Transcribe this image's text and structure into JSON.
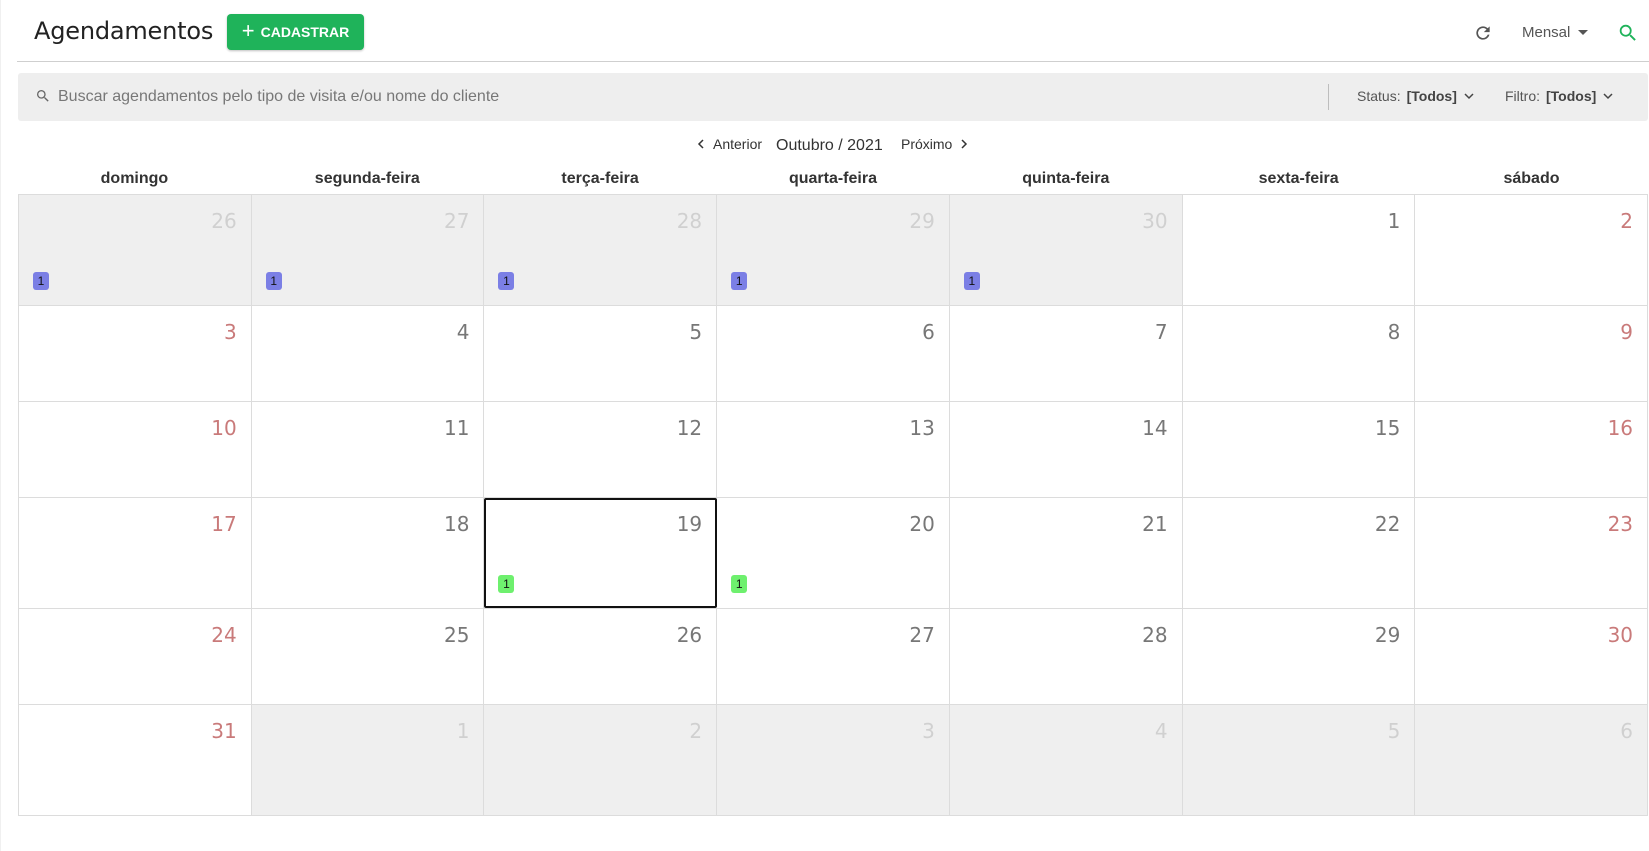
{
  "header": {
    "title": "Agendamentos",
    "add_button_label": "CADASTRAR",
    "view_mode": "Mensal"
  },
  "search": {
    "placeholder": "Buscar agendamentos pelo tipo de visita e/ou nome do cliente",
    "status_label": "Status:",
    "status_value": "[Todos]",
    "filter_label": "Filtro:",
    "filter_value": "[Todos]"
  },
  "nav": {
    "prev_label": "Anterior",
    "month_label": "Outubro / 2021",
    "next_label": "Próximo"
  },
  "colors": {
    "primary": "#1fb35a",
    "badge_blue": "#7b7fe5",
    "badge_green": "#6ef06e",
    "weekend_text": "#c97a7a"
  },
  "calendar": {
    "weekdays": [
      "domingo",
      "segunda-feira",
      "terça-feira",
      "quarta-feira",
      "quinta-feira",
      "sexta-feira",
      "sábado"
    ],
    "weeks": [
      [
        {
          "day": "26",
          "outside": true,
          "badge": "1",
          "badge_color": "blue"
        },
        {
          "day": "27",
          "outside": true,
          "badge": "1",
          "badge_color": "blue"
        },
        {
          "day": "28",
          "outside": true,
          "badge": "1",
          "badge_color": "blue"
        },
        {
          "day": "29",
          "outside": true,
          "badge": "1",
          "badge_color": "blue"
        },
        {
          "day": "30",
          "outside": true,
          "badge": "1",
          "badge_color": "blue"
        },
        {
          "day": "1"
        },
        {
          "day": "2"
        }
      ],
      [
        {
          "day": "3"
        },
        {
          "day": "4"
        },
        {
          "day": "5"
        },
        {
          "day": "6"
        },
        {
          "day": "7"
        },
        {
          "day": "8"
        },
        {
          "day": "9"
        }
      ],
      [
        {
          "day": "10"
        },
        {
          "day": "11"
        },
        {
          "day": "12"
        },
        {
          "day": "13"
        },
        {
          "day": "14"
        },
        {
          "day": "15"
        },
        {
          "day": "16"
        }
      ],
      [
        {
          "day": "17"
        },
        {
          "day": "18"
        },
        {
          "day": "19",
          "today": true,
          "badge": "1",
          "badge_color": "green"
        },
        {
          "day": "20",
          "badge": "1",
          "badge_color": "green"
        },
        {
          "day": "21"
        },
        {
          "day": "22"
        },
        {
          "day": "23"
        }
      ],
      [
        {
          "day": "24"
        },
        {
          "day": "25"
        },
        {
          "day": "26"
        },
        {
          "day": "27"
        },
        {
          "day": "28"
        },
        {
          "day": "29"
        },
        {
          "day": "30"
        }
      ],
      [
        {
          "day": "31"
        },
        {
          "day": "1",
          "outside": true
        },
        {
          "day": "2",
          "outside": true
        },
        {
          "day": "3",
          "outside": true
        },
        {
          "day": "4",
          "outside": true
        },
        {
          "day": "5",
          "outside": true
        },
        {
          "day": "6",
          "outside": true
        }
      ]
    ]
  }
}
